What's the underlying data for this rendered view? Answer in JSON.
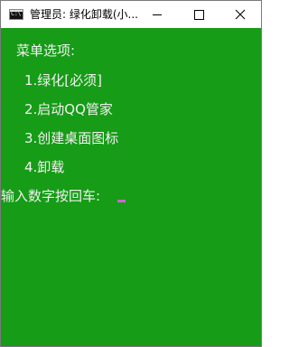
{
  "window": {
    "title": "管理员:  绿化卸载(小..."
  },
  "icons": {
    "app": "console-app-icon",
    "minimize": "minimize-icon",
    "maximize": "maximize-icon",
    "close": "close-icon"
  },
  "app_icon_text": "C:\\",
  "console": {
    "header": "菜单选项:",
    "options": [
      "1.绿化[必须]",
      "2.启动QQ管家",
      "3.创建桌面图标",
      "4.卸载"
    ],
    "prompt": "输入数字按回车:"
  },
  "colors": {
    "console_background": "#169c16",
    "console_text": "#f0f0f0",
    "cursor": "#d064d8"
  }
}
